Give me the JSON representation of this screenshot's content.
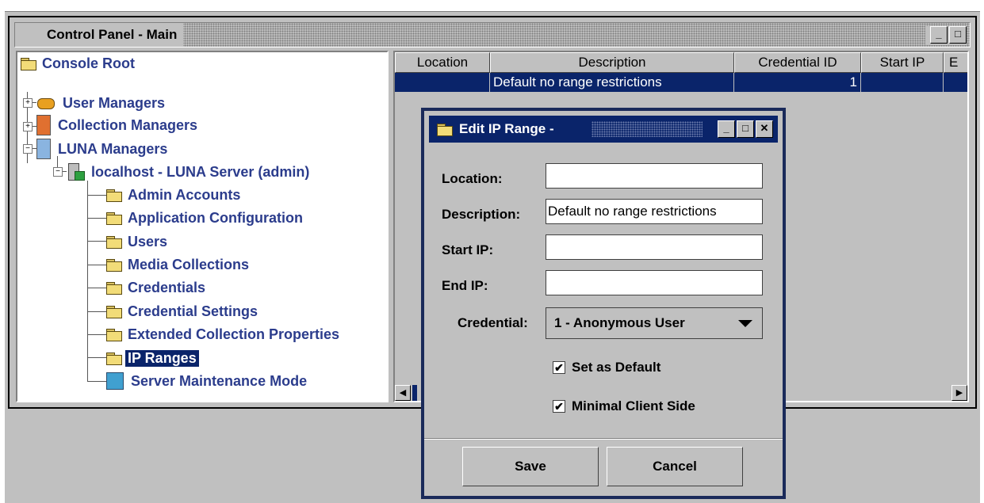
{
  "main_window": {
    "title": "Control Panel - Main",
    "minimize_glyph": "_",
    "maximize_glyph": "□"
  },
  "tree": {
    "root": "Console Root",
    "top_nodes": [
      "User Managers",
      "Collection Managers",
      "LUNA Managers"
    ],
    "server": "localhost - LUNA Server (admin)",
    "children": [
      "Admin Accounts",
      "Application Configuration",
      "Users",
      "Media Collections",
      "Credentials",
      "Credential Settings",
      "Extended Collection Properties",
      "IP Ranges",
      "Server Maintenance Mode"
    ],
    "selected": "IP Ranges"
  },
  "table": {
    "headers": [
      "Location",
      "Description",
      "Credential ID",
      "Start IP",
      "E"
    ],
    "row": [
      "",
      "Default no range restrictions",
      "1",
      "",
      ""
    ]
  },
  "dialog": {
    "title": "Edit IP Range -",
    "location_label": "Location:",
    "location_value": "",
    "description_label": "Description:",
    "description_value": "Default no range restrictions",
    "start_ip_label": "Start IP:",
    "start_ip_value": "",
    "end_ip_label": "End IP:",
    "end_ip_value": "",
    "credential_label": "Credential:",
    "credential_value": "1 - Anonymous User",
    "set_default_label": "Set as Default",
    "set_default_checked": true,
    "minimal_client_label": "Minimal Client Side",
    "minimal_client_checked": true,
    "save_label": "Save",
    "cancel_label": "Cancel",
    "check_glyph": "✔",
    "close_glyph": "✕"
  },
  "colors": {
    "selection": "#0a246a",
    "tree_text": "#2b3c8c",
    "panel": "#c0c0c0"
  }
}
